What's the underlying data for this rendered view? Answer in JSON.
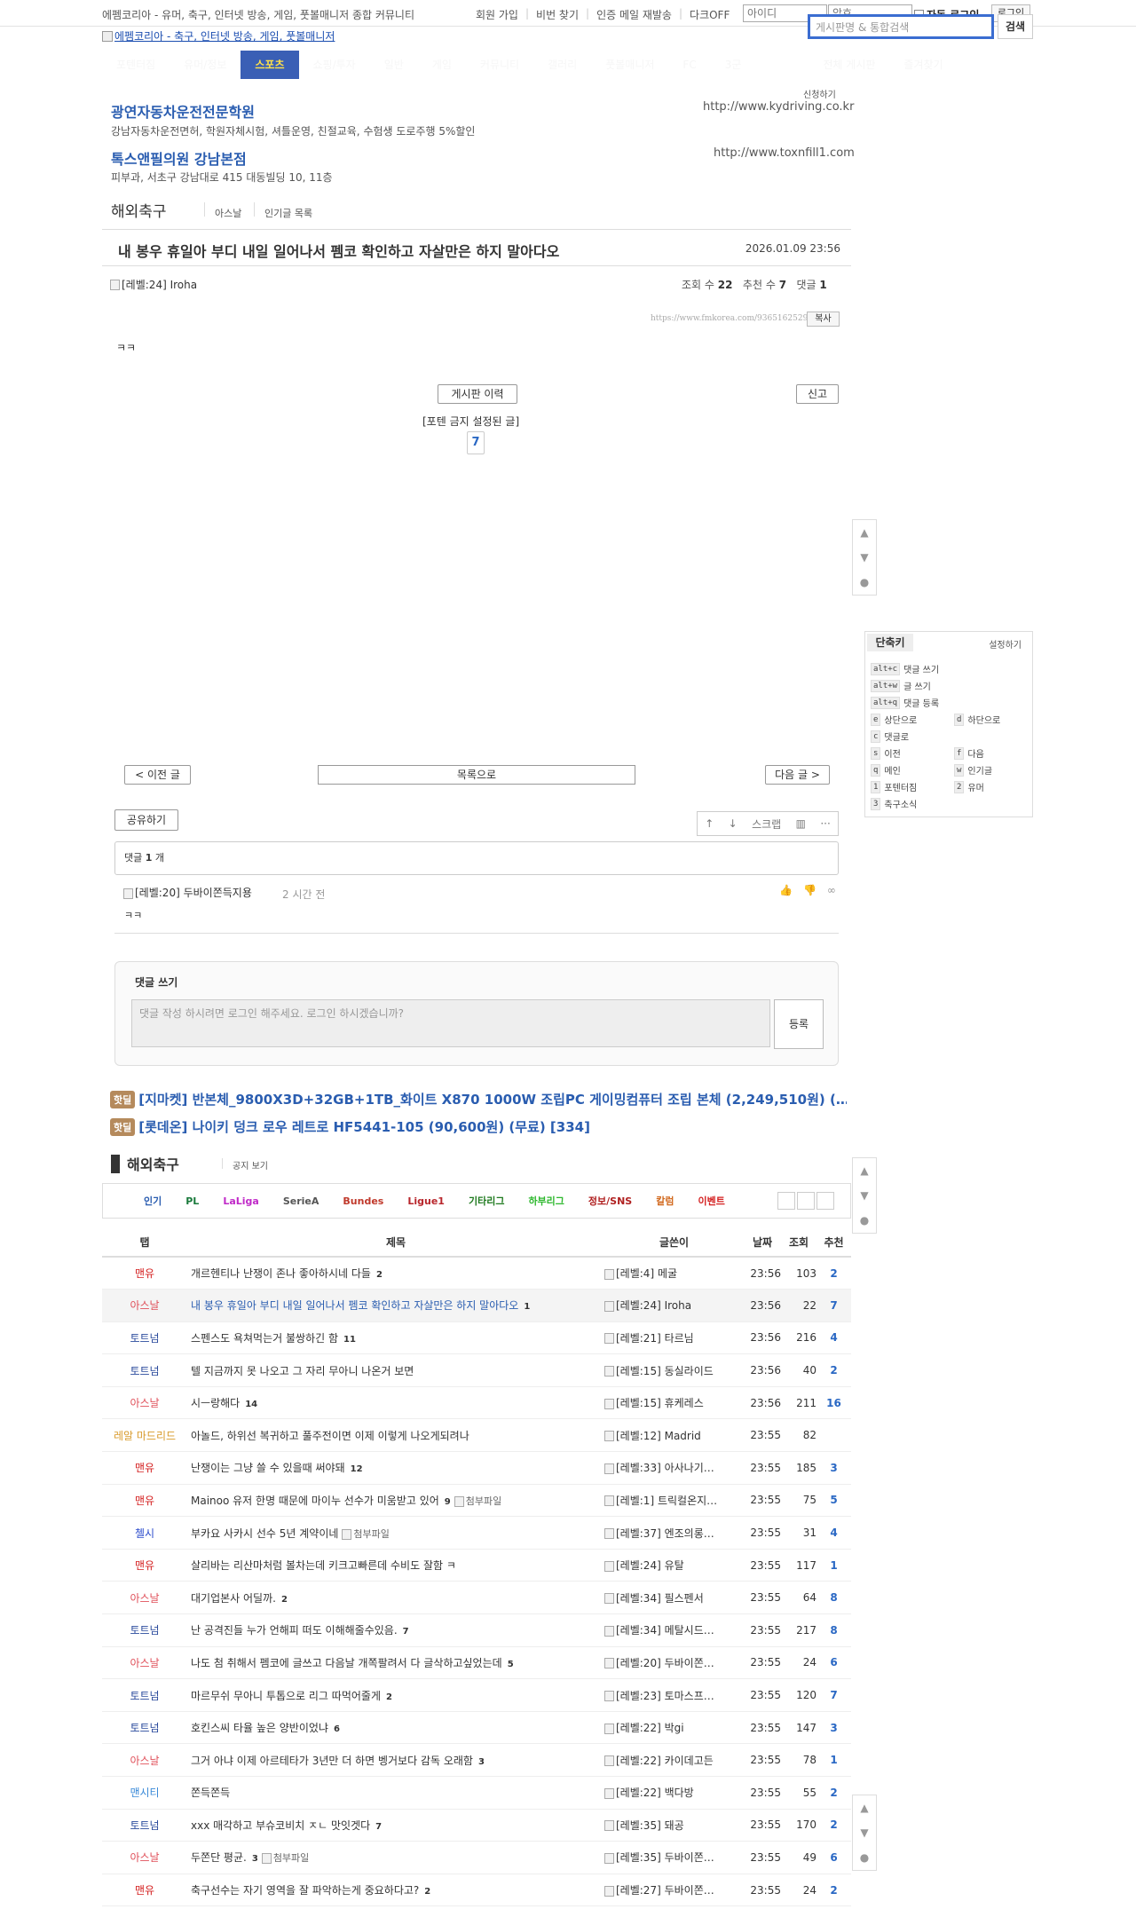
{
  "topbar": {
    "site_desc": "에펨코리아 - 유머, 축구, 인터넷 방송, 게임, 풋볼매니저 종합 커뮤니티",
    "links": [
      "회원 가입",
      "비번 찾기",
      "인증 메일 재발송",
      "다크OFF"
    ],
    "id_placeholder": "아이디",
    "pw_placeholder": "암호",
    "auto_login": "자동 로그인",
    "login": "로그인"
  },
  "logo_alt": "에펨코리아 - 축구, 인터넷 방송, 게임, 풋볼매니저",
  "search": {
    "placeholder": "게시판명 & 통합검색",
    "button": "검색"
  },
  "menu": [
    "포텐터짐",
    "유머/정보",
    "스포츠",
    "쇼핑/투자",
    "일반",
    "게임",
    "커뮤니티",
    "갤러리",
    "풋볼매니저",
    "FC",
    "3군",
    "전체 게시판",
    "즐겨찾기"
  ],
  "ads": {
    "request": "신청하기",
    "items": [
      {
        "title": "광연자동차운전전문학원",
        "desc": "강남자동차운전면허, 학원자체시험, 셔틀운영, 친절교육, 수험생 도로주행 5%할인",
        "url": "http://www.kydriving.co.kr"
      },
      {
        "title": "톡스앤필의원 강남본점",
        "desc": "피부과, 서초구 강남대로 415 대동빌딩 10, 11층",
        "url": "http://www.toxnfill1.com"
      }
    ]
  },
  "board": {
    "title": "해외축구",
    "sub1": "아스날",
    "sub2": "인기글 목록"
  },
  "post": {
    "title": "내 봉우 휴일아 부디 내일 일어나서 펨코 확인하고 자살만은 하지 말아다오",
    "date": "2026.01.09 23:56",
    "author_level": "[레벨:24]",
    "author": "Iroha",
    "views_label": "조회 수",
    "views": "22",
    "recs_label": "추천 수",
    "recs": "7",
    "comments_label": "댓글",
    "comments": "1",
    "url": "https://www.fmkorea.com/9365162529",
    "copy": "복사",
    "body": "ㅋㅋ",
    "history_btn": "게시판 이력",
    "report_btn": "신고",
    "banned_text": "[포텐 금지 설정된 글]",
    "rec_count": "7"
  },
  "shortcuts": {
    "title": "단축키",
    "setting": "설정하기",
    "rows": [
      {
        "key": "alt+c",
        "label": "댓글 쓰기"
      },
      {
        "key": "alt+w",
        "label": "글 쓰기"
      },
      {
        "key": "alt+q",
        "label": "댓글 등록"
      },
      {
        "key": "e",
        "label": "상단으로",
        "key2": "d",
        "label2": "하단으로"
      },
      {
        "key": "c",
        "label": "댓글로"
      },
      {
        "key": "s",
        "label": "이전",
        "key2": "f",
        "label2": "다음"
      },
      {
        "key": "q",
        "label": "메인",
        "key2": "w",
        "label2": "인기글"
      },
      {
        "key": "1",
        "label": "포텐터짐",
        "key2": "2",
        "label2": "유머"
      },
      {
        "key": "3",
        "label": "축구소식"
      }
    ]
  },
  "nav": {
    "prev": "< 이전 글",
    "list": "목록으로",
    "next": "다음 글 >"
  },
  "share": {
    "label": "공유하기",
    "scrap": "스크랩"
  },
  "comments": {
    "count_prefix": "댓글",
    "count": "1",
    "count_suffix": "개",
    "level": "[레벨:20]",
    "author": "두바이쫀득지용",
    "time": "2 시간 전",
    "body": "ㅋㅋ"
  },
  "write": {
    "title": "댓글 쓰기",
    "placeholder": "댓글 작성 하시려면 로그인 해주세요. 로그인 하시겠습니까?",
    "submit": "등록"
  },
  "hotdeals": [
    {
      "badge": "핫딜",
      "text": "[지마켓] 반본체_9800X3D+32GB+1TB_화이트 X870 1000W 조립PC 게이밍컴퓨터 조립 본체 (2,249,510원) (…"
    },
    {
      "badge": "핫딜",
      "text": "[롯데온] 나이키 덩크 로우 레트로 HF5441-105 (90,600원) (무료) [334]"
    }
  ],
  "list": {
    "title": "해외축구",
    "notice_toggle": "공지 보기",
    "tabs": [
      {
        "label": "인기",
        "color": "#2a5db0"
      },
      {
        "label": "PL",
        "color": "#1a7a3c"
      },
      {
        "label": "LaLiga",
        "color": "#c02ac8"
      },
      {
        "label": "SerieA",
        "color": "#555555"
      },
      {
        "label": "Bundes",
        "color": "#c0392b"
      },
      {
        "label": "Ligue1",
        "color": "#b8262c"
      },
      {
        "label": "기타리그",
        "color": "#1f7a1f"
      },
      {
        "label": "하부리그",
        "color": "#2eb82e"
      },
      {
        "label": "정보/SNS",
        "color": "#b02020"
      },
      {
        "label": "칼럼",
        "color": "#d2691e"
      },
      {
        "label": "이벤트",
        "color": "#d42020"
      }
    ],
    "headers": [
      "탭",
      "제목",
      "글쓴이",
      "날짜",
      "조회",
      "추천"
    ],
    "rows": [
      {
        "cat": "맨유",
        "color": "#d42020",
        "title": "개르헨티나 난쟁이 존나 좋아하시네 다들",
        "cc": "2",
        "att": "",
        "lv": "[레벨:4]",
        "author": "메굴",
        "time": "23:56",
        "views": "103",
        "rec": "2"
      },
      {
        "cat": "아스날",
        "color": "#e0505a",
        "title": "내 봉우 휴일아 부디 내일 일어나서 펨코 확인하고 자살만은 하지 말아다오",
        "cc": "1",
        "att": "",
        "lv": "[레벨:24]",
        "author": "Iroha",
        "time": "23:56",
        "views": "22",
        "rec": "7",
        "current": true
      },
      {
        "cat": "토트넘",
        "color": "#2a4a9c",
        "title": "스펜스도 욕쳐먹는거 불쌍하긴 함",
        "cc": "11",
        "att": "",
        "lv": "[레벨:21]",
        "author": "타르님",
        "time": "23:56",
        "views": "216",
        "rec": "4"
      },
      {
        "cat": "토트넘",
        "color": "#2a4a9c",
        "title": "텔 지금까지 못 나오고 그 자리 무아니 나온거 보면",
        "cc": "",
        "att": "",
        "lv": "[레벨:15]",
        "author": "동실라이드",
        "time": "23:56",
        "views": "40",
        "rec": "2"
      },
      {
        "cat": "아스날",
        "color": "#e0505a",
        "title": "시ㅡ랑해다",
        "cc": "14",
        "att": "",
        "lv": "[레벨:15]",
        "author": "휴케레스",
        "time": "23:56",
        "views": "211",
        "rec": "16"
      },
      {
        "cat": "레알 마드리드",
        "color": "#d89a2a",
        "title": "아놀드, 하위선 복귀하고 풀주전이면 이제 이렇게 나오게되려나",
        "cc": "",
        "att": "",
        "lv": "[레벨:12]",
        "author": "Madrid",
        "time": "23:55",
        "views": "82",
        "rec": ""
      },
      {
        "cat": "맨유",
        "color": "#d42020",
        "title": "난쟁이는 그냥 쓸 수 있을때 써야돼",
        "cc": "12",
        "att": "",
        "lv": "[레벨:33]",
        "author": "아사나기…",
        "time": "23:55",
        "views": "185",
        "rec": "3"
      },
      {
        "cat": "맨유",
        "color": "#d42020",
        "title": "Mainoo 유저 한명 때문에 마이누 선수가 미움받고 있어",
        "cc": "9",
        "att": "첨부파일",
        "lv": "[레벨:1]",
        "author": "트릭컬온지…",
        "time": "23:55",
        "views": "75",
        "rec": "5"
      },
      {
        "cat": "첼시",
        "color": "#2a4acb",
        "title": "부카요 사카시 선수 5년 계약이네",
        "cc": "",
        "att": "첨부파일",
        "lv": "[레벨:37]",
        "author": "엔조의롱…",
        "time": "23:55",
        "views": "31",
        "rec": "4"
      },
      {
        "cat": "맨유",
        "color": "#d42020",
        "title": "살리바는 리산마처럼 볼차는데 키크고빠른데 수비도 잘함 ㅋ",
        "cc": "",
        "att": "",
        "lv": "[레벨:24]",
        "author": "유탈",
        "time": "23:55",
        "views": "117",
        "rec": "1"
      },
      {
        "cat": "아스날",
        "color": "#e0505a",
        "title": "대기업본사 어딜까.",
        "cc": "2",
        "att": "",
        "lv": "[레벨:34]",
        "author": "필스펜서",
        "time": "23:55",
        "views": "64",
        "rec": "8"
      },
      {
        "cat": "토트넘",
        "color": "#2a4a9c",
        "title": "난 공격진들 누가 언해피 떠도 이해해줄수있음.",
        "cc": "7",
        "att": "",
        "lv": "[레벨:34]",
        "author": "메탈시드…",
        "time": "23:55",
        "views": "217",
        "rec": "8"
      },
      {
        "cat": "아스날",
        "color": "#e0505a",
        "title": "나도 첨 취해서 펨코에 글쓰고 다음날 개쪽팔려서 다 글삭하고싶었는데",
        "cc": "5",
        "att": "",
        "lv": "[레벨:20]",
        "author": "두바이쫀…",
        "time": "23:55",
        "views": "24",
        "rec": "6"
      },
      {
        "cat": "토트넘",
        "color": "#2a4a9c",
        "title": "마르무쉬 무아니 투톱으로 리그 따먹어줄게",
        "cc": "2",
        "att": "",
        "lv": "[레벨:23]",
        "author": "토마스프…",
        "time": "23:55",
        "views": "120",
        "rec": "7"
      },
      {
        "cat": "토트넘",
        "color": "#2a4a9c",
        "title": "호킨스씨 타율 높은 양반이었냐",
        "cc": "6",
        "att": "",
        "lv": "[레벨:22]",
        "author": "박gi",
        "time": "23:55",
        "views": "147",
        "rec": "3"
      },
      {
        "cat": "아스날",
        "color": "#e0505a",
        "title": "그거 아냐 이제 아르테타가 3년만 더 하면 벵거보다 감독 오래함",
        "cc": "3",
        "att": "",
        "lv": "[레벨:22]",
        "author": "카이데고든",
        "time": "23:55",
        "views": "78",
        "rec": "1"
      },
      {
        "cat": "맨시티",
        "color": "#3a8ad8",
        "title": "쫀득쫀득",
        "cc": "",
        "att": "",
        "lv": "[레벨:22]",
        "author": "백다방",
        "time": "23:55",
        "views": "55",
        "rec": "2"
      },
      {
        "cat": "토트넘",
        "color": "#2a4a9c",
        "title": "xxx 매각하고 부슈코비치 ㅈㄴ 맛잇겟다",
        "cc": "7",
        "att": "",
        "lv": "[레벨:35]",
        "author": "돼공",
        "time": "23:55",
        "views": "170",
        "rec": "2"
      },
      {
        "cat": "아스날",
        "color": "#e0505a",
        "title": "두쫀단 평균.",
        "cc": "3",
        "att": "첨부파일",
        "lv": "[레벨:35]",
        "author": "두바이쫀…",
        "time": "23:55",
        "views": "49",
        "rec": "6"
      },
      {
        "cat": "맨유",
        "color": "#d42020",
        "title": "축구선수는 자기 영역을 잘 파악하는게 중요하다고?",
        "cc": "2",
        "att": "",
        "lv": "[레벨:27]",
        "author": "두바이쫀…",
        "time": "23:55",
        "views": "24",
        "rec": "2"
      }
    ]
  }
}
